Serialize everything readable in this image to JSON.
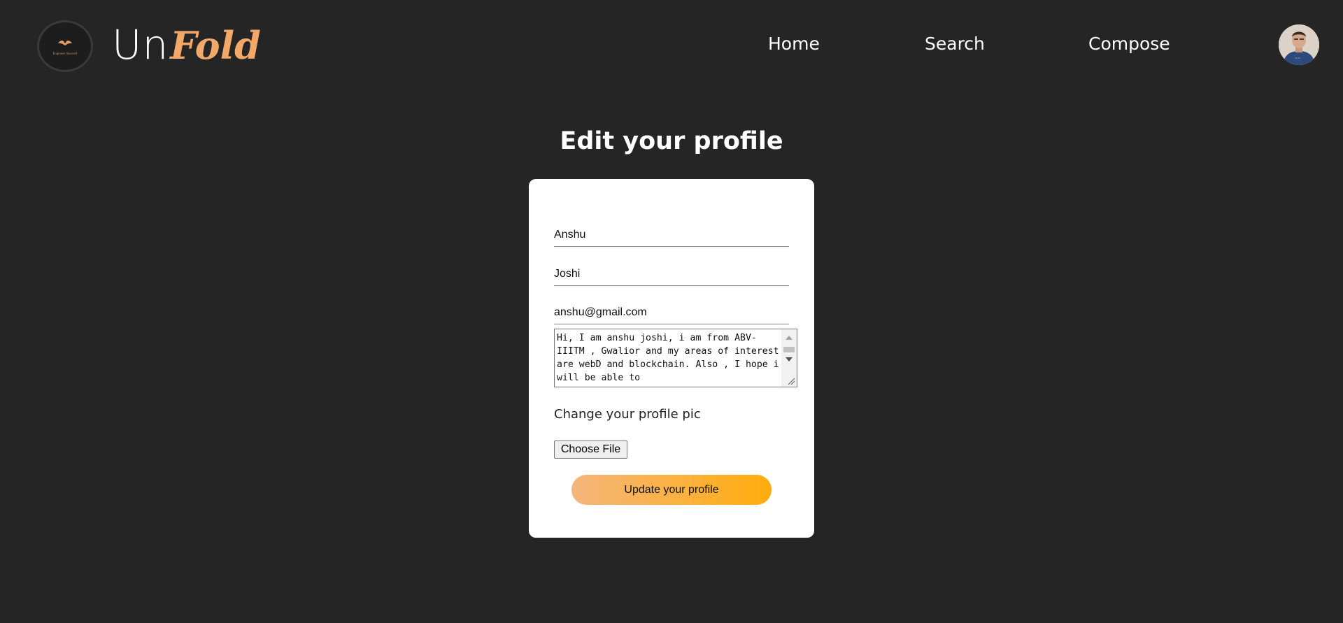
{
  "navbar": {
    "badge_text": "Engineer Yourself",
    "brand_un": "Un",
    "brand_fold": "Fold",
    "links": [
      "Home",
      "Search",
      "Compose"
    ]
  },
  "page": {
    "title": "Edit your profile"
  },
  "form": {
    "first_name": "Anshu",
    "last_name": "Joshi",
    "email": "anshu@gmail.com",
    "bio": "Hi, I am anshu joshi, i am from ABV-IIITM , Gwalior and my areas of interest are webD and blockchain. Also , I hope i will be able to",
    "pic_label": "Change your profile pic",
    "file_button": "Choose File",
    "submit_label": "Update your profile"
  },
  "colors": {
    "background": "#252525",
    "accent": "#f2a869",
    "button_gradient_start": "#f4b57c",
    "button_gradient_end": "#ffac0a"
  }
}
